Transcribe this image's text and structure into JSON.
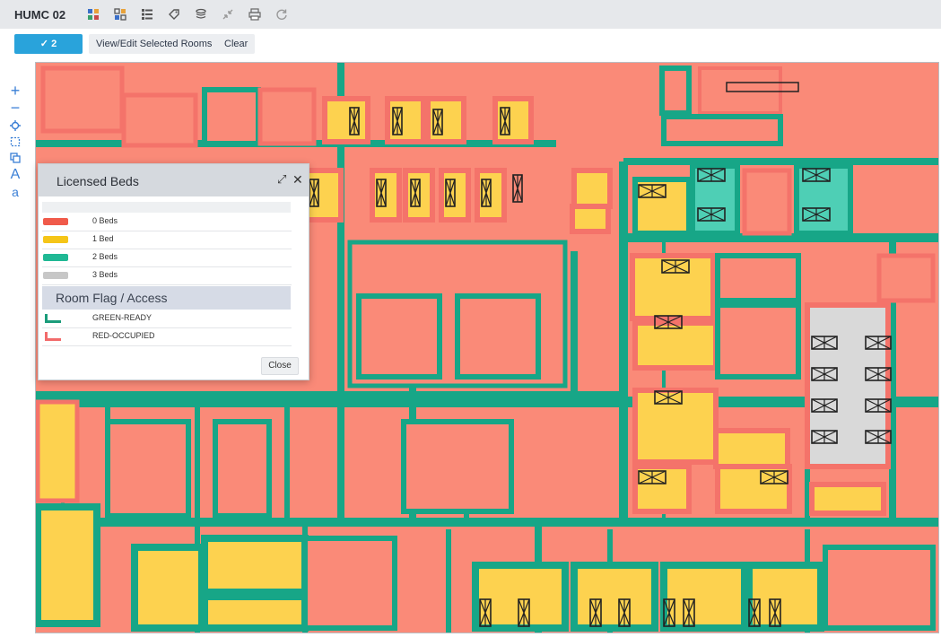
{
  "app": {
    "title": "HUMC 02"
  },
  "toolbar": {
    "icons": [
      "grid-icon",
      "grid-alt-icon",
      "list-icon",
      "tag-icon",
      "layers-icon",
      "collapse-icon",
      "print-icon",
      "refresh-icon"
    ]
  },
  "actions": {
    "selected_label": "2 selected",
    "view_edit_label": "View/Edit Selected Rooms",
    "clear_label": "Clear"
  },
  "side_tools": [
    "plus-icon",
    "minus-icon",
    "locate-icon",
    "select-area-icon",
    "copy-icon",
    "font-large-icon",
    "font-small-icon"
  ],
  "side_tool_glyphs": {
    "large_text": "A",
    "small_text": "a"
  },
  "legend": {
    "title": "Licensed Beds",
    "items": [
      {
        "label": "0 Beds",
        "color": "#f05a4a"
      },
      {
        "label": "1 Bed",
        "color": "#f5c518"
      },
      {
        "label": "2 Beds",
        "color": "#1fb894"
      },
      {
        "label": "3 Beds",
        "color": "#c7c7c7"
      }
    ],
    "section_title": "Room Flag / Access",
    "flags": [
      {
        "label": "GREEN-READY",
        "color": "#1a9c7a"
      },
      {
        "label": "RED-OCCUPIED",
        "color": "#f26b6b"
      }
    ],
    "close_label": "Close"
  },
  "colors": {
    "room_empty": "#fa8a78",
    "room_one_bed": "#fdd24f",
    "room_two_beds": "#4ecfb5",
    "room_three_beds": "#d9d9d9",
    "green_ready_border": "#17a687",
    "red_occupied_border": "#f4736a",
    "accent": "#29a3db"
  }
}
